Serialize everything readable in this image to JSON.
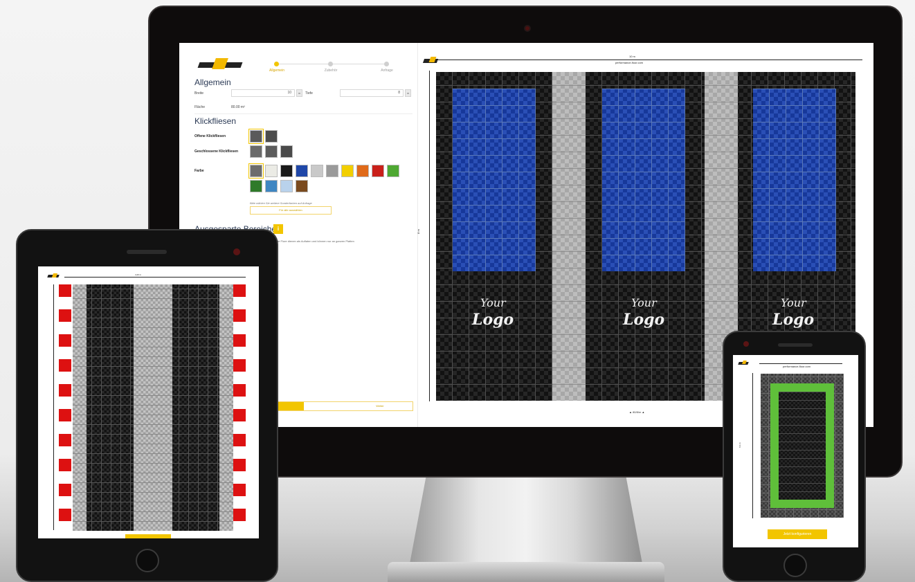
{
  "desktop": {
    "steps": [
      {
        "label": "Allgemein",
        "active": true
      },
      {
        "label": "Zubehör",
        "active": false
      },
      {
        "label": "Anfrage",
        "active": false
      }
    ],
    "allgemein": {
      "title": "Allgemein",
      "breite_label": "Breite",
      "breite_value": "10",
      "tiefe_label": "Tiefe",
      "tiefe_value": "8",
      "unit": "m",
      "flaeche_label": "Fläche",
      "flaeche_value": "80.00 m²"
    },
    "klickfliesen": {
      "title": "Klickfliesen",
      "offen_label": "Offene Klickfliesen",
      "geschlossen_label": "Geschlossene Klickfliesen",
      "farbe_label": "Farbe",
      "offen_swatches": [
        "#5a5a5a",
        "#4c4c4c"
      ],
      "geschlossen_swatches": [
        "#6a6a6a",
        "#5c5c5c",
        "#4a4a4a"
      ],
      "colors": [
        "#6d6d6d",
        "#ebebe5",
        "#1a1a1a",
        "#1f47a8",
        "#c9c9c9",
        "#9a9a9a",
        "#f2cf00",
        "#e06a1a",
        "#c9201a",
        "#4ea832",
        "#2f7a2a",
        "#3f86c2",
        "#b9d2ec",
        "#7a4a1e"
      ],
      "hint": "Bitte wählen Sie weitere Sonderfarben auf Anfrage",
      "button": "Für alle auswählen"
    },
    "ausgesparte": {
      "title": "Ausgesparte Bereiche",
      "info": "i",
      "text": "…lassen sie an angrenzenden Bauteilen ausgeschnitten werden. …ie Flure dienen als Auflaten und können nur an ganzen Platten"
    },
    "footer_button": "Weiter",
    "progress": 0.2,
    "floor": {
      "width_label": "10 m",
      "brand_label": "performance-floor.com",
      "depth_label": "8 m",
      "area_label": "▲ 80/8/m ▲",
      "logo_line1": "Your",
      "logo_line2": "Logo"
    }
  },
  "tablet": {
    "width_label": "4,20 m",
    "brand_label": "performance-floor.com",
    "depth_label": "8,40 m"
  },
  "phone": {
    "width_label": "4 m",
    "brand_label": "performance-floor.com",
    "depth_label": "8,4 m",
    "button": "Jetzt konfigurieren"
  },
  "colors": {
    "accent": "#f2c500",
    "tile_blue": "#1f47a8",
    "tile_black": "#121212",
    "tile_grey": "#b0b0b0",
    "kerb_red": "#dd1111",
    "tile_green": "#5fbf3a"
  }
}
